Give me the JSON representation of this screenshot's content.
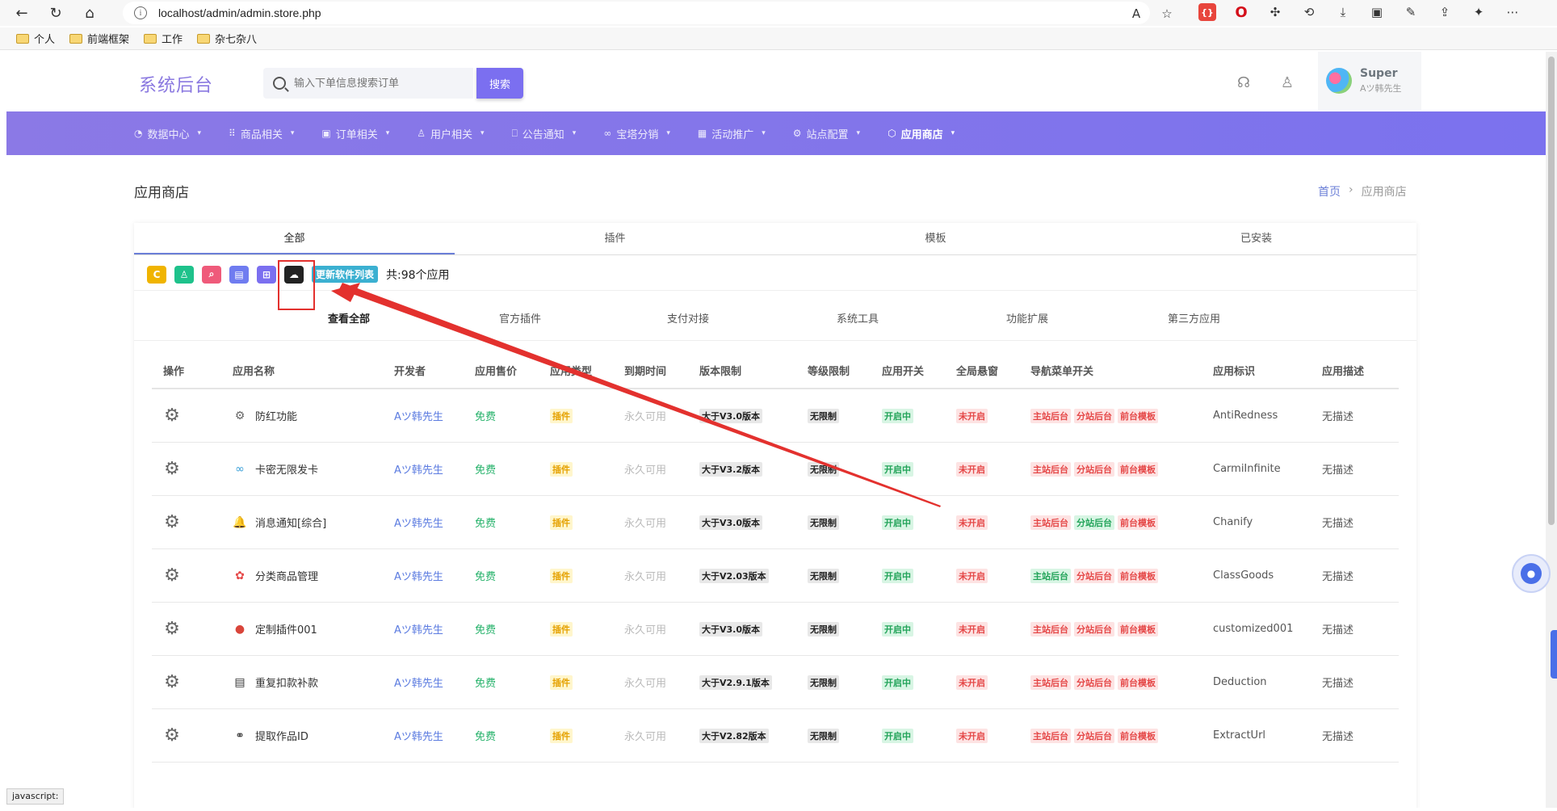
{
  "browser": {
    "url": "localhost/admin/admin.store.php",
    "bookmarks": [
      "个人",
      "前端框架",
      "工作",
      "杂七杂八"
    ],
    "status": "javascript:"
  },
  "header": {
    "brand": "系统后台",
    "search_placeholder": "输入下单信息搜索订单",
    "search_button": "搜索",
    "user_name": "Super",
    "user_sub": "Aツ韩先生"
  },
  "nav": {
    "items": [
      {
        "label": "数据中心"
      },
      {
        "label": "商品相关"
      },
      {
        "label": "订单相关"
      },
      {
        "label": "用户相关"
      },
      {
        "label": "公告通知"
      },
      {
        "label": "宝塔分销"
      },
      {
        "label": "活动推广"
      },
      {
        "label": "站点配置"
      },
      {
        "label": "应用商店"
      }
    ]
  },
  "page": {
    "title": "应用商店",
    "breadcrumb_home": "首页",
    "breadcrumb_sep": "›",
    "breadcrumb_current": "应用商店"
  },
  "tabs": [
    "全部",
    "插件",
    "模板",
    "已安装"
  ],
  "toolbar": {
    "update_label": "更新软件列表",
    "count": "共:98个应用"
  },
  "filters": [
    "查看全部",
    "官方插件",
    "支付对接",
    "系统工具",
    "功能扩展",
    "第三方应用"
  ],
  "table": {
    "headers": [
      "操作",
      "应用名称",
      "开发者",
      "应用售价",
      "应用类型",
      "到期时间",
      "版本限制",
      "等级限制",
      "应用开关",
      "全局悬窗",
      "导航菜单开关",
      "应用标识",
      "应用描述"
    ],
    "rows": [
      {
        "name": "防红功能",
        "dev": "Aツ韩先生",
        "price": "免费",
        "type": "插件",
        "exp": "永久可用",
        "ver": "大于V3.0版本",
        "lvl": "无限制",
        "sw": "开启中",
        "float": "未开启",
        "menu": [
          "主站后台",
          "分站后台",
          "前台模板"
        ],
        "menu_on": [
          false,
          false,
          false
        ],
        "id": "AntiRedness",
        "desc": "无描述"
      },
      {
        "name": "卡密无限发卡",
        "dev": "Aツ韩先生",
        "price": "免费",
        "type": "插件",
        "exp": "永久可用",
        "ver": "大于V3.2版本",
        "lvl": "无限制",
        "sw": "开启中",
        "float": "未开启",
        "menu": [
          "主站后台",
          "分站后台",
          "前台模板"
        ],
        "menu_on": [
          false,
          false,
          false
        ],
        "id": "CarmiInfinite",
        "desc": "无描述"
      },
      {
        "name": "消息通知[综合]",
        "dev": "Aツ韩先生",
        "price": "免费",
        "type": "插件",
        "exp": "永久可用",
        "ver": "大于V3.0版本",
        "lvl": "无限制",
        "sw": "开启中",
        "float": "未开启",
        "menu": [
          "主站后台",
          "分站后台",
          "前台模板"
        ],
        "menu_on": [
          false,
          true,
          false
        ],
        "id": "Chanify",
        "desc": "无描述"
      },
      {
        "name": "分类商品管理",
        "dev": "Aツ韩先生",
        "price": "免费",
        "type": "插件",
        "exp": "永久可用",
        "ver": "大于V2.03版本",
        "lvl": "无限制",
        "sw": "开启中",
        "float": "未开启",
        "menu": [
          "主站后台",
          "分站后台",
          "前台模板"
        ],
        "menu_on": [
          true,
          false,
          false
        ],
        "id": "ClassGoods",
        "desc": "无描述"
      },
      {
        "name": "定制插件001",
        "dev": "Aツ韩先生",
        "price": "免费",
        "type": "插件",
        "exp": "永久可用",
        "ver": "大于V3.0版本",
        "lvl": "无限制",
        "sw": "开启中",
        "float": "未开启",
        "menu": [
          "主站后台",
          "分站后台",
          "前台模板"
        ],
        "menu_on": [
          false,
          false,
          false
        ],
        "id": "customized001",
        "desc": "无描述"
      },
      {
        "name": "重复扣款补款",
        "dev": "Aツ韩先生",
        "price": "免费",
        "type": "插件",
        "exp": "永久可用",
        "ver": "大于V2.9.1版本",
        "lvl": "无限制",
        "sw": "开启中",
        "float": "未开启",
        "menu": [
          "主站后台",
          "分站后台",
          "前台模板"
        ],
        "menu_on": [
          false,
          false,
          false
        ],
        "id": "Deduction",
        "desc": "无描述"
      },
      {
        "name": "提取作品ID",
        "dev": "Aツ韩先生",
        "price": "免费",
        "type": "插件",
        "exp": "永久可用",
        "ver": "大于V2.82版本",
        "lvl": "无限制",
        "sw": "开启中",
        "float": "未开启",
        "menu": [
          "主站后台",
          "分站后台",
          "前台模板"
        ],
        "menu_on": [
          false,
          false,
          false
        ],
        "id": "ExtractUrl",
        "desc": "无描述"
      }
    ]
  },
  "colors": {
    "accent": "#7b6ff0",
    "nav_bg": "#8b79e6",
    "link": "#5b7be0",
    "free": "#25b26a",
    "on": "#23a45a",
    "off": "#e54848",
    "annotation": "#e3312e"
  },
  "icons": {
    "row_icons": [
      "document-gear-icon",
      "infinity-icon",
      "bell-icon",
      "flower-icon",
      "pouch-icon",
      "clipboard-icon",
      "link-icon"
    ]
  }
}
